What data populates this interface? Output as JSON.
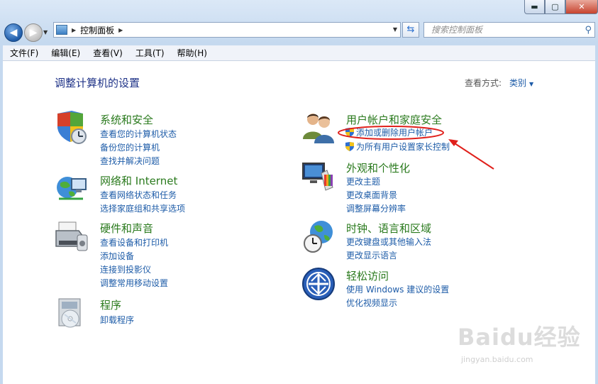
{
  "window": {
    "caption": {
      "minimize": "▬",
      "maximize": "▢",
      "close": "✕"
    }
  },
  "navbar": {
    "back_glyph": "◀",
    "forward_glyph": "▶",
    "address": {
      "separator": "▶",
      "crumb": "控制面板"
    },
    "search_placeholder": "搜索控制面板"
  },
  "menu": [
    "文件(F)",
    "编辑(E)",
    "查看(V)",
    "工具(T)",
    "帮助(H)"
  ],
  "content": {
    "title": "调整计算机的设置",
    "view_by_label": "查看方式:",
    "view_by_value": "类别",
    "categories": {
      "security": {
        "heading": "系统和安全",
        "links": [
          "查看您的计算机状态",
          "备份您的计算机",
          "查找并解决问题"
        ]
      },
      "network": {
        "heading": "网络和 Internet",
        "links": [
          "查看网络状态和任务",
          "选择家庭组和共享选项"
        ]
      },
      "hardware": {
        "heading": "硬件和声音",
        "links": [
          "查看设备和打印机",
          "添加设备",
          "连接到投影仪",
          "调整常用移动设置"
        ]
      },
      "programs": {
        "heading": "程序",
        "links": [
          "卸载程序"
        ]
      },
      "users": {
        "heading": "用户帐户和家庭安全",
        "links": [
          "添加或删除用户帐户",
          "为所有用户设置家长控制"
        ]
      },
      "appearance": {
        "heading": "外观和个性化",
        "links": [
          "更改主题",
          "更改桌面背景",
          "调整屏幕分辨率"
        ]
      },
      "clock": {
        "heading": "时钟、语言和区域",
        "links": [
          "更改键盘或其他输入法",
          "更改显示语言"
        ]
      },
      "access": {
        "heading": "轻松访问",
        "links": [
          "使用 Windows 建议的设置",
          "优化视频显示"
        ]
      }
    }
  },
  "watermark": {
    "brand": "Baidu经验",
    "url": "jingyan.baidu.com"
  },
  "colors": {
    "heading": "#2a7a1d",
    "link": "#1e5ca8",
    "title": "#1e3287",
    "annotation": "#e0201b"
  }
}
